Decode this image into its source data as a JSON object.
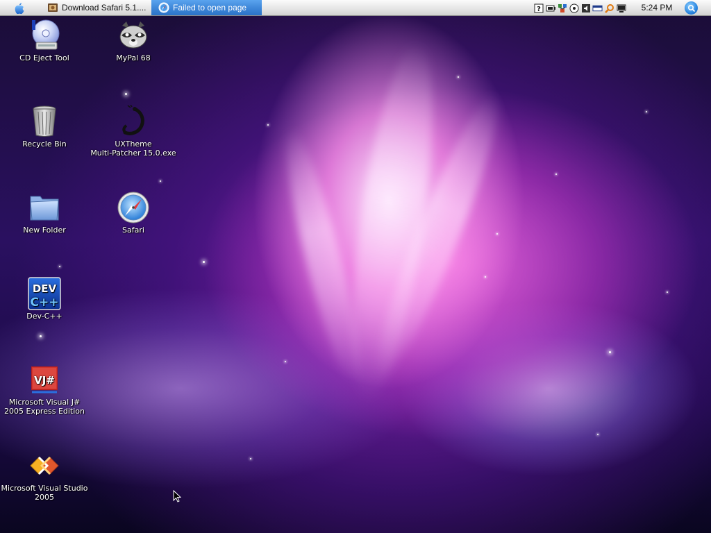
{
  "taskbar": {
    "tasks": [
      {
        "label": "Download Safari 5.1....",
        "active": false
      },
      {
        "label": "Failed to open page",
        "active": true
      }
    ],
    "tray_icons": [
      "help-icon",
      "battery-icon",
      "network-icon",
      "media-icon",
      "volume-icon",
      "keyboard-icon",
      "search-tool-icon",
      "display-icon"
    ],
    "clock": "5:24 PM"
  },
  "desktop": {
    "icons": [
      {
        "label": "CD Eject Tool",
        "icon": "cd-eject-icon"
      },
      {
        "label": "MyPal 68",
        "icon": "raccoon-icon"
      },
      {
        "label": "Recycle Bin",
        "icon": "trash-icon"
      },
      {
        "label": "UXTheme\nMulti-Patcher 15.0.exe",
        "icon": "patcher-icon"
      },
      {
        "label": "New Folder",
        "icon": "folder-icon"
      },
      {
        "label": "Safari",
        "icon": "compass-icon"
      },
      {
        "label": "Dev-C++",
        "icon": "devcpp-icon"
      },
      {
        "label": "Microsoft Visual J#\n2005 Express Edition",
        "icon": "vjsharp-icon"
      },
      {
        "label": "Microsoft Visual Studio\n2005",
        "icon": "visual-studio-icon"
      }
    ]
  },
  "colors": {
    "active_task": "#3d86d8",
    "taskbar_bg": "#e6e6e6"
  }
}
